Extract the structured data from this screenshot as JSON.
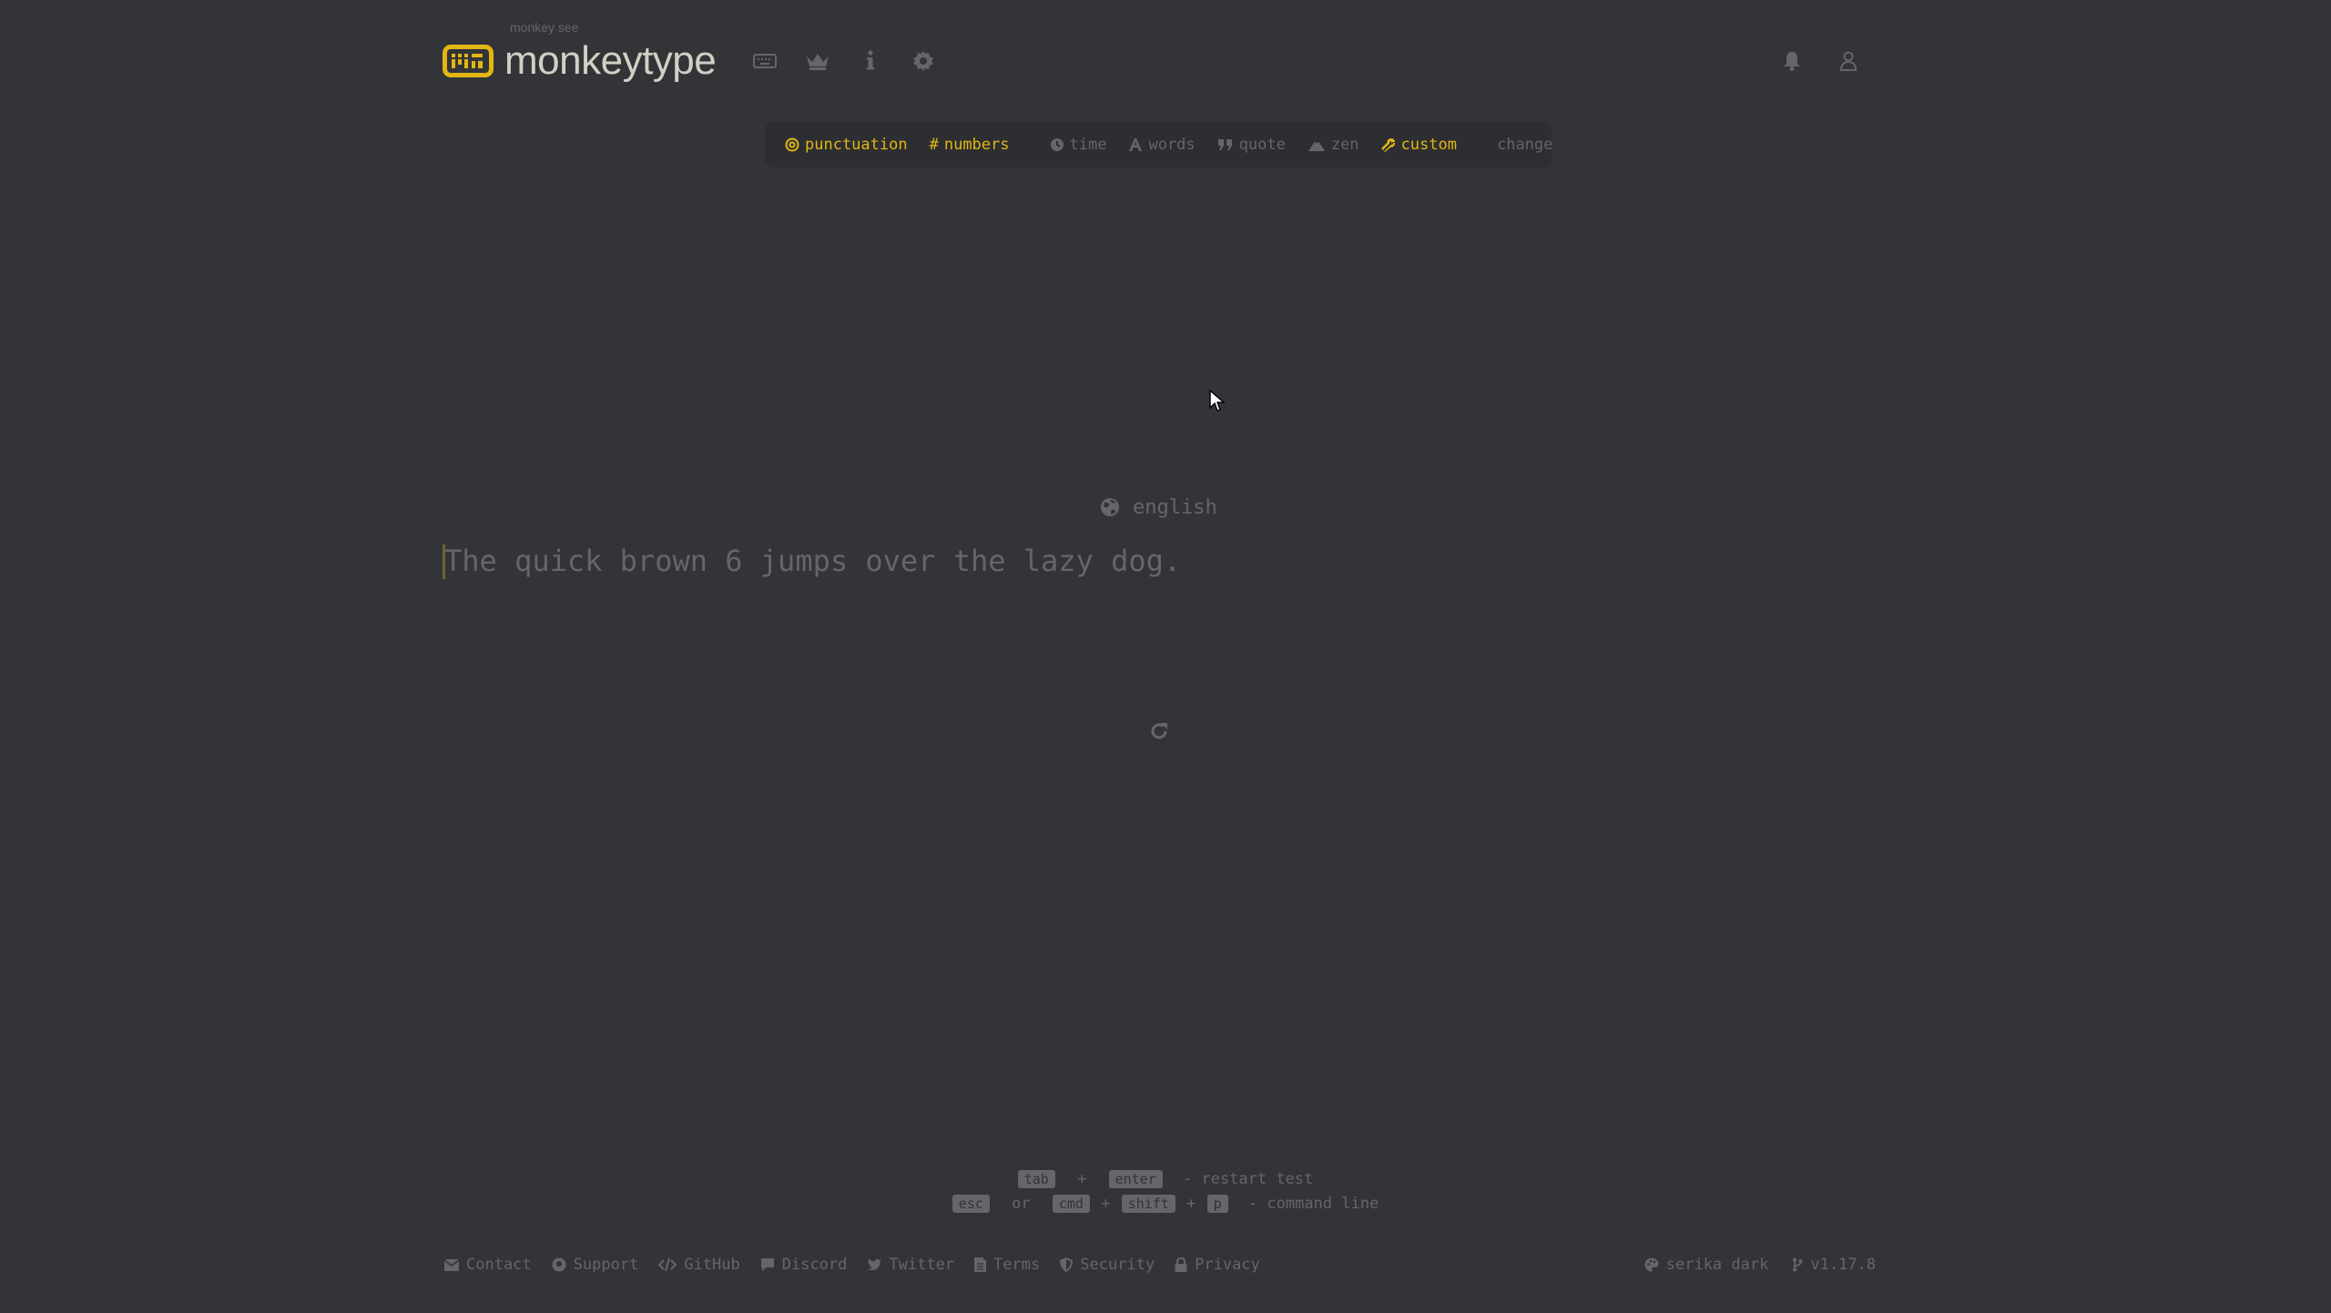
{
  "header": {
    "logo_top": "monkey see",
    "logo_text": "monkeytype",
    "nav_icons": [
      "keyboard-icon",
      "crown-icon",
      "info-icon",
      "gear-icon"
    ],
    "right_icons": [
      "bell-icon",
      "user-icon"
    ]
  },
  "config": {
    "punctuation": "punctuation",
    "numbers": "numbers",
    "time": "time",
    "words": "words",
    "quote": "quote",
    "zen": "zen",
    "custom": "custom",
    "change": "change",
    "active": [
      "punctuation",
      "numbers",
      "custom"
    ]
  },
  "test": {
    "language": "english",
    "text": "The quick brown 6 jumps over the lazy dog."
  },
  "keytips": {
    "line1": {
      "k1": "tab",
      "plus": "+",
      "k2": "enter",
      "desc": "- restart test"
    },
    "line2": {
      "k1": "esc",
      "or": "or",
      "k2": "cmd",
      "plus1": "+",
      "k3": "shift",
      "plus2": "+",
      "k4": "p",
      "desc": "- command line"
    }
  },
  "footer": {
    "links": [
      "Contact",
      "Support",
      "GitHub",
      "Discord",
      "Twitter",
      "Terms",
      "Security",
      "Privacy"
    ],
    "theme": "serika dark",
    "version": "v1.17.8"
  },
  "colors": {
    "background": "#323437",
    "accent": "#e2b714",
    "sub": "#646669",
    "text": "#d1d0c5",
    "sub_alt": "#2c2e31"
  }
}
